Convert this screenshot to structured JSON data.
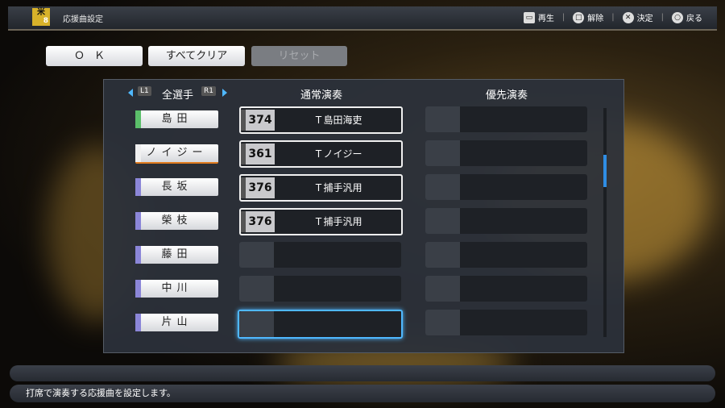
{
  "header": {
    "logo_text": "米",
    "logo_number": "8",
    "title": "応援曲設定",
    "hints": [
      {
        "icon": "touchpad-icon",
        "glyph": "▭",
        "label": "再生"
      },
      {
        "icon": "square-button-icon",
        "glyph": "□",
        "label": "解除"
      },
      {
        "icon": "cross-button-icon",
        "glyph": "✕",
        "label": "決定"
      },
      {
        "icon": "circle-button-icon",
        "glyph": "○",
        "label": "戻る"
      }
    ]
  },
  "buttons": {
    "ok": "ＯＫ",
    "clear_all": "すべてクリア",
    "reset": "リセット"
  },
  "panel": {
    "l1": "L1",
    "r1": "R1",
    "filter": "全選手",
    "col_normal": "通常演奏",
    "col_priority": "優先演奏"
  },
  "players": [
    {
      "name": "島田",
      "bar_color": "#5bbf6a",
      "song_no": "374",
      "song": "Ｔ島田海吏"
    },
    {
      "name": "ノイジー",
      "bar_color": "#f0f0f0",
      "song_no": "361",
      "song": "Ｔノイジー"
    },
    {
      "name": "長坂",
      "bar_color": "#8b86d8",
      "song_no": "376",
      "song": "Ｔ捕手汎用"
    },
    {
      "name": "榮枝",
      "bar_color": "#8b86d8",
      "song_no": "376",
      "song": "Ｔ捕手汎用"
    },
    {
      "name": "藤田",
      "bar_color": "#8b86d8",
      "song_no": "",
      "song": ""
    },
    {
      "name": "中川",
      "bar_color": "#8b86d8",
      "song_no": "",
      "song": ""
    },
    {
      "name": "片山",
      "bar_color": "#8b86d8",
      "song_no": "",
      "song": ""
    }
  ],
  "footer": {
    "help": "打席で演奏する応援曲を設定します。"
  },
  "colors": {
    "accent_cursor": "#4fb8ff",
    "scroll_thumb": "#2f8de4",
    "logo": "#d8b22a"
  }
}
